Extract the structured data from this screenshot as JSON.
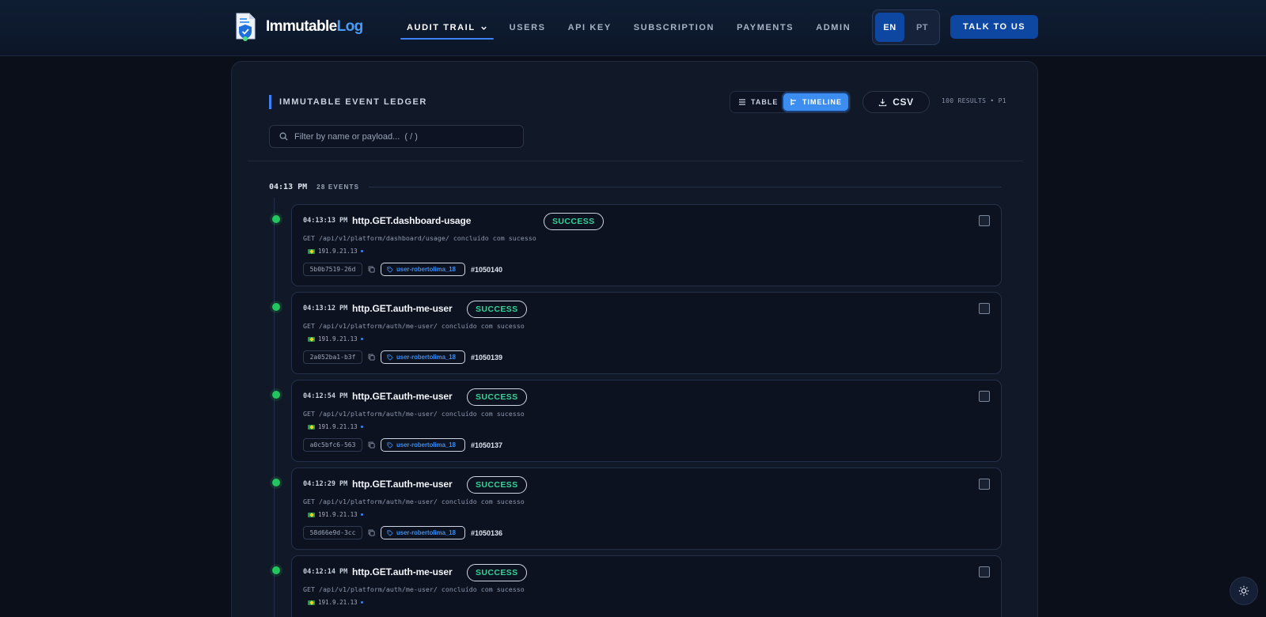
{
  "brand": {
    "name_part1": "Immutable",
    "name_part2": "Log"
  },
  "nav": {
    "items": [
      {
        "label": "AUDIT TRAIL",
        "active": true,
        "dropdown": true
      },
      {
        "label": "USERS"
      },
      {
        "label": "API KEY"
      },
      {
        "label": "SUBSCRIPTION"
      },
      {
        "label": "PAYMENTS"
      },
      {
        "label": "ADMIN"
      }
    ],
    "lang": {
      "en": "EN",
      "pt": "PT",
      "selected": "EN"
    },
    "cta_label": "TALK TO US"
  },
  "ledger": {
    "title": "IMMUTABLE EVENT LEDGER",
    "search_placeholder": "Filter by name or payload...  ( / )",
    "view_table": "TABLE",
    "view_timeline": "TIMELINE",
    "active_view": "TIMELINE",
    "csv_label": "CSV",
    "results": "100 RESULTS • P1"
  },
  "group": {
    "time": "04:13 PM",
    "count": "28 EVENTS"
  },
  "events": [
    {
      "time": "04:13:13 PM",
      "name": "http.GET.dashboard-usage",
      "status": "SUCCESS",
      "description": "GET /api/v1/platform/dashboard/usage/ concluído com sucesso",
      "ip": "191.9.21.13",
      "hash": "5b0b7519-26d",
      "user": "user-robertolima_18",
      "seq": "#1050140"
    },
    {
      "time": "04:13:12 PM",
      "name": "http.GET.auth-me-user",
      "status": "SUCCESS",
      "description": "GET /api/v1/platform/auth/me-user/ concluído com sucesso",
      "ip": "191.9.21.13",
      "hash": "2a052ba1-b3f",
      "user": "user-robertolima_18",
      "seq": "#1050139"
    },
    {
      "time": "04:12:54 PM",
      "name": "http.GET.auth-me-user",
      "status": "SUCCESS",
      "description": "GET /api/v1/platform/auth/me-user/ concluído com sucesso",
      "ip": "191.9.21.13",
      "hash": "a0c5bfc6-563",
      "user": "user-robertolima_18",
      "seq": "#1050137"
    },
    {
      "time": "04:12:29 PM",
      "name": "http.GET.auth-me-user",
      "status": "SUCCESS",
      "description": "GET /api/v1/platform/auth/me-user/ concluído com sucesso",
      "ip": "191.9.21.13",
      "hash": "58d66e9d-3cc",
      "user": "user-robertolima_18",
      "seq": "#1050136"
    },
    {
      "time": "04:12:14 PM",
      "name": "http.GET.auth-me-user",
      "status": "SUCCESS",
      "description": "GET /api/v1/platform/auth/me-user/ concluído com sucesso",
      "ip": "191.9.21.13",
      "hash": "",
      "user": "",
      "seq": ""
    }
  ],
  "icons": {
    "logo": "document-shield-icon",
    "search": "search-icon",
    "table": "list-icon",
    "timeline": "timeline-icon",
    "download": "download-icon",
    "copy": "copy-icon",
    "tag": "tag-icon",
    "theme": "sun-icon"
  },
  "colors": {
    "accent": "#3b82f6",
    "success": "#22c55e",
    "brand_blue": "#0d47a1"
  }
}
